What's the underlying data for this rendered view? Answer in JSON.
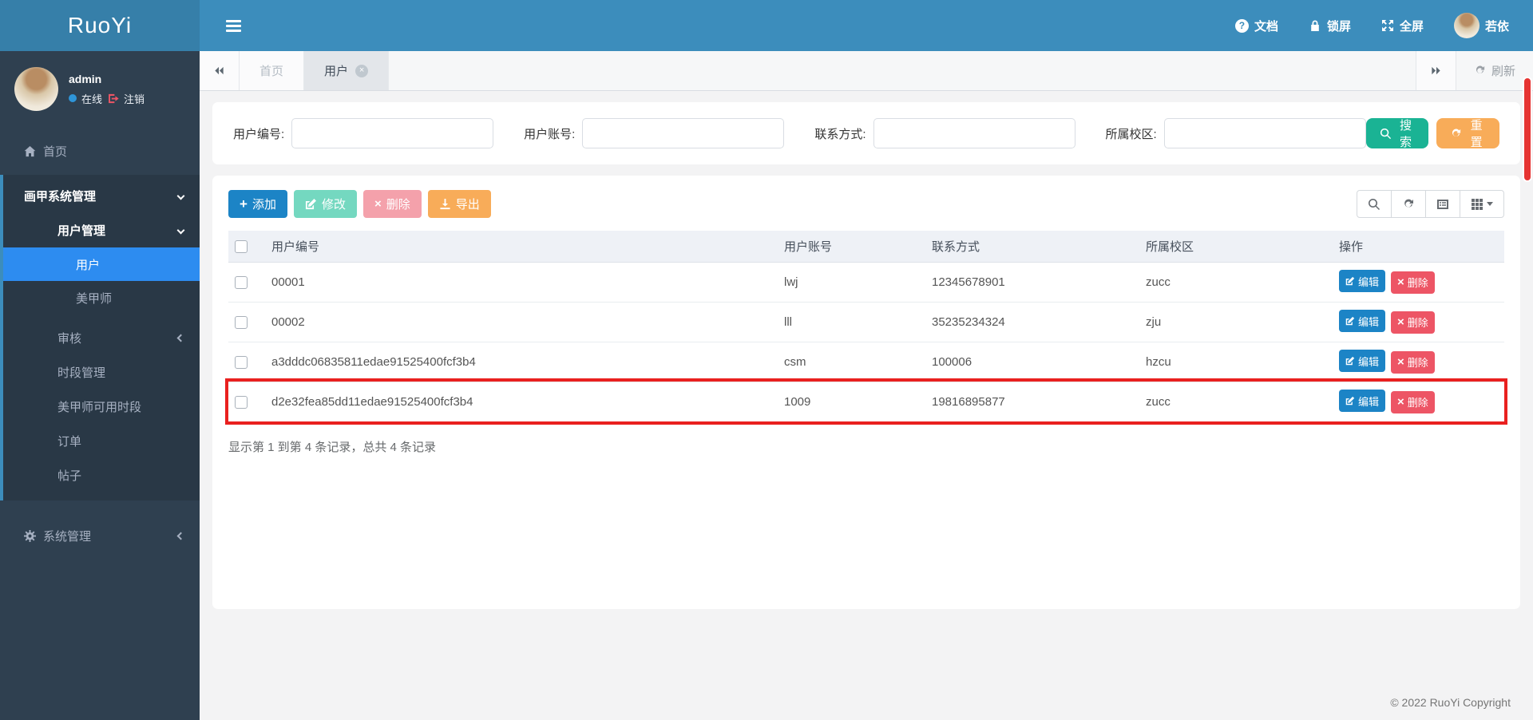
{
  "colors": {
    "navbar_bg": "#3c8dbc",
    "logo_bg": "#367fa9",
    "sidebar_bg": "#2f4050",
    "sidebar_active_item": "#2d8cf0",
    "active_tree_accent": "#3c8dbc",
    "btn_primary": "#1c84c6",
    "btn_success": "#1ab394",
    "btn_success_disabled": "#74d8c0",
    "btn_danger": "#ed5565",
    "btn_danger_disabled": "#f4a1ab",
    "btn_warning": "#f8ac59",
    "table_header_bg": "#eef1f6",
    "highlight_border": "#e9201f",
    "scrollbar_thumb": "#e63432"
  },
  "navbar": {
    "logo": "RuoYi",
    "doc": "文档",
    "lock": "锁屏",
    "fullscreen": "全屏",
    "username": "若依"
  },
  "sidebar": {
    "user": {
      "name": "admin",
      "status": "在线",
      "logout": "注销"
    },
    "menu": {
      "home": "首页",
      "root": "画甲系统管理",
      "user_mgmt": "用户管理",
      "user": "用户",
      "manicurist": "美甲师",
      "audit": "审核",
      "period": "时段管理",
      "manicurist_period": "美甲师可用时段",
      "order": "订单",
      "post": "帖子",
      "system": "系统管理"
    }
  },
  "tabs": {
    "home": "首页",
    "user": "用户",
    "refresh": "刷新"
  },
  "search": {
    "fields": [
      {
        "label": "用户编号:",
        "value": ""
      },
      {
        "label": "用户账号:",
        "value": ""
      },
      {
        "label": "联系方式:",
        "value": ""
      },
      {
        "label": "所属校区:",
        "value": ""
      }
    ],
    "search_btn": "搜索",
    "reset_btn": "重置"
  },
  "toolbar": {
    "add": "添加",
    "modify": "修改",
    "remove": "删除",
    "export": "导出"
  },
  "table": {
    "headers": [
      "用户编号",
      "用户账号",
      "联系方式",
      "所属校区",
      "操作"
    ],
    "rows": [
      {
        "id": "00001",
        "account": "lwj",
        "contact": "12345678901",
        "campus": "zucc"
      },
      {
        "id": "00002",
        "account": "lll",
        "contact": "35235234324",
        "campus": "zju"
      },
      {
        "id": "a3dddc06835811edae91525400fcf3b4",
        "account": "csm",
        "contact": "100006",
        "campus": "hzcu"
      },
      {
        "id": "d2e32fea85dd11edae91525400fcf3b4",
        "account": "1009",
        "contact": "19816895877",
        "campus": "zucc",
        "highlighted": true
      }
    ],
    "edit_btn": "编辑",
    "delete_btn": "删除",
    "summary": "显示第 1 到第 4 条记录，总共 4 条记录"
  },
  "footer": {
    "copyright": "© 2022 RuoYi Copyright"
  }
}
